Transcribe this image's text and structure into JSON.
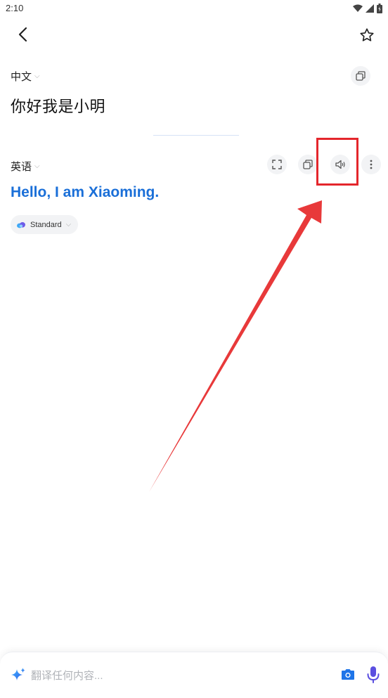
{
  "status_bar": {
    "time": "2:10"
  },
  "icons": {
    "back": "chevron-left-icon",
    "favorite": "star-outline-icon",
    "copy": "copy-icon",
    "fullscreen": "fullscreen-icon",
    "speaker": "speaker-icon",
    "more": "more-vertical-icon",
    "camera": "camera-icon",
    "mic": "microphone-icon",
    "sparkle": "sparkle-icon"
  },
  "source": {
    "language": "中文",
    "text": "你好我是小明"
  },
  "target": {
    "language": "英语",
    "text": "Hello, I am Xiaoming."
  },
  "style_chip": {
    "label": "Standard"
  },
  "input": {
    "placeholder": "翻译任何内容..."
  },
  "colors": {
    "accent": "#1a6fd8",
    "highlight": "#e4262c",
    "mic": "#5b4fe0"
  }
}
